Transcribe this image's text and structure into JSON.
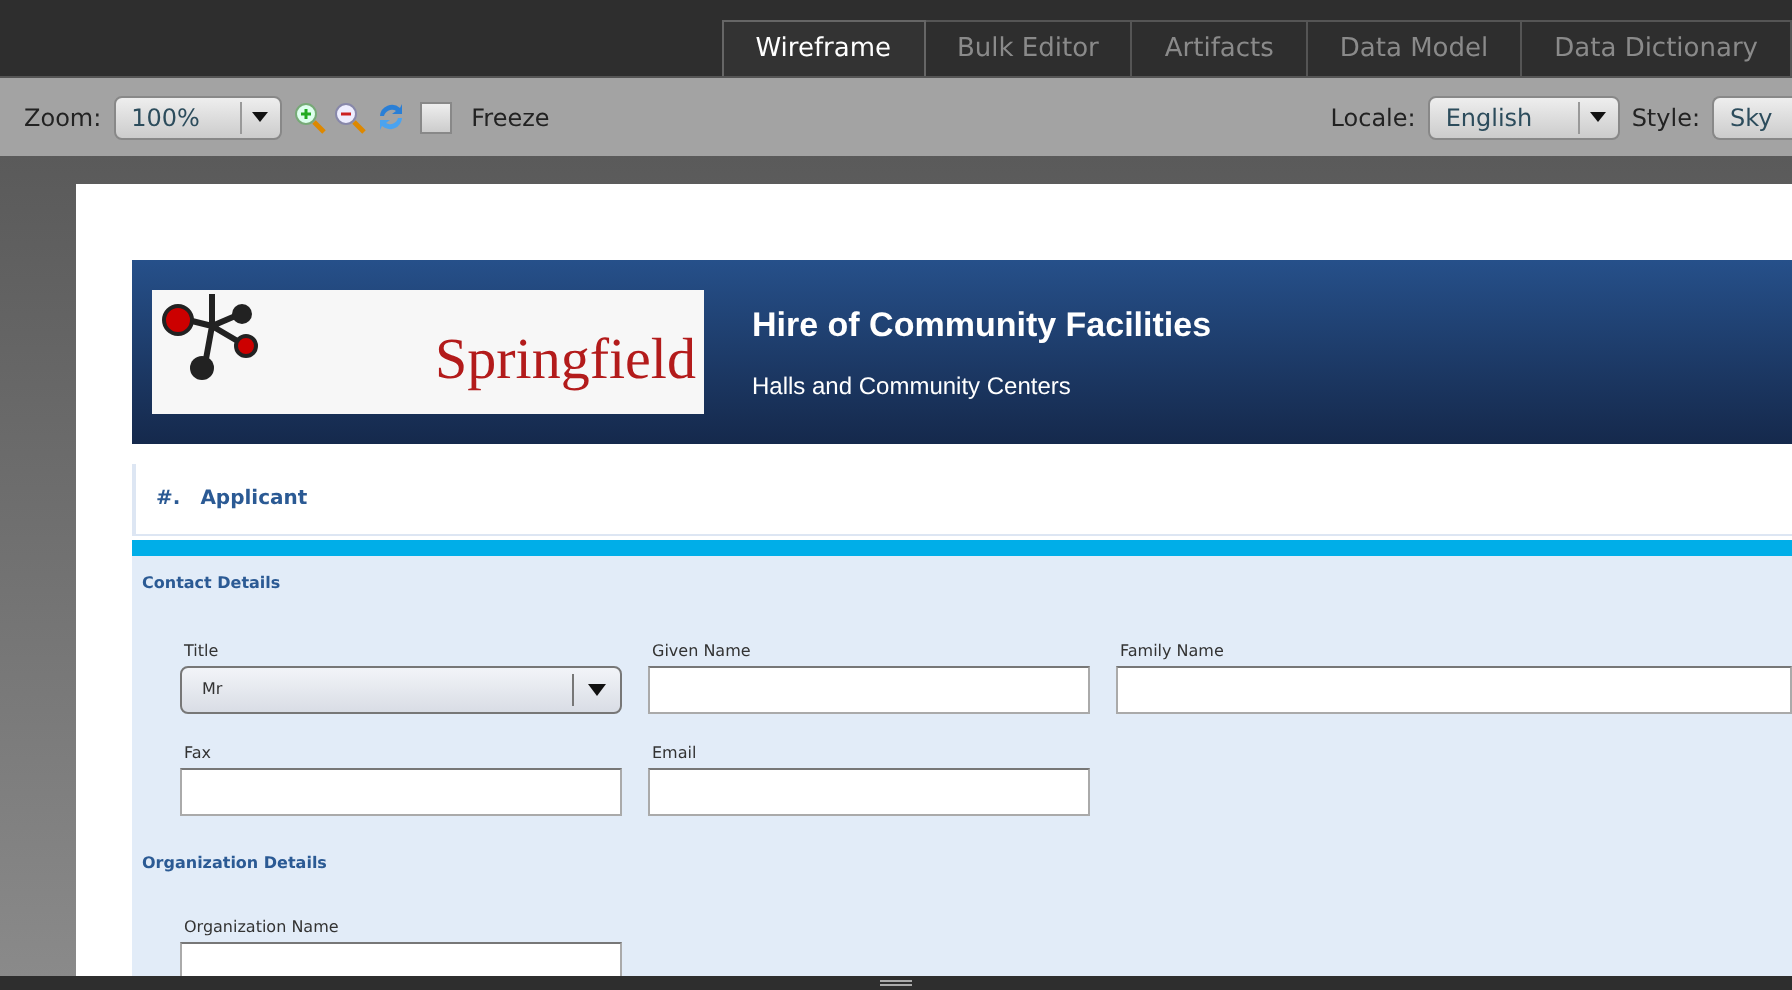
{
  "tabs": [
    {
      "label": "Wireframe",
      "selected": true
    },
    {
      "label": "Bulk Editor",
      "selected": false
    },
    {
      "label": "Artifacts",
      "selected": false
    },
    {
      "label": "Data Model",
      "selected": false
    },
    {
      "label": "Data Dictionary",
      "selected": false
    }
  ],
  "toolbar": {
    "zoom_label": "Zoom:",
    "zoom_value": "100%",
    "freeze": {
      "label": "Freeze",
      "checked": false
    },
    "locale_label": "Locale:",
    "locale_value": "English",
    "style_label": "Style:",
    "style_value": "Sky"
  },
  "header": {
    "logo_text": "Springfield",
    "title": "Hire of Community Facilities",
    "subtitle": "Halls and Community Centers"
  },
  "section": {
    "number": "#.",
    "title": "Applicant"
  },
  "groups": [
    {
      "title": "Contact Details",
      "rows": [
        [
          {
            "kind": "select",
            "label": "Title",
            "value": "Mr"
          },
          {
            "kind": "input",
            "label": "Given Name"
          },
          {
            "kind": "input",
            "label": "Family Name"
          }
        ],
        [
          {
            "kind": "input",
            "label": "Fax"
          },
          {
            "kind": "input",
            "label": "Email"
          }
        ]
      ]
    },
    {
      "title": "Organization Details",
      "rows": [
        [
          {
            "kind": "input",
            "label": "Organization Name"
          }
        ]
      ]
    }
  ]
}
